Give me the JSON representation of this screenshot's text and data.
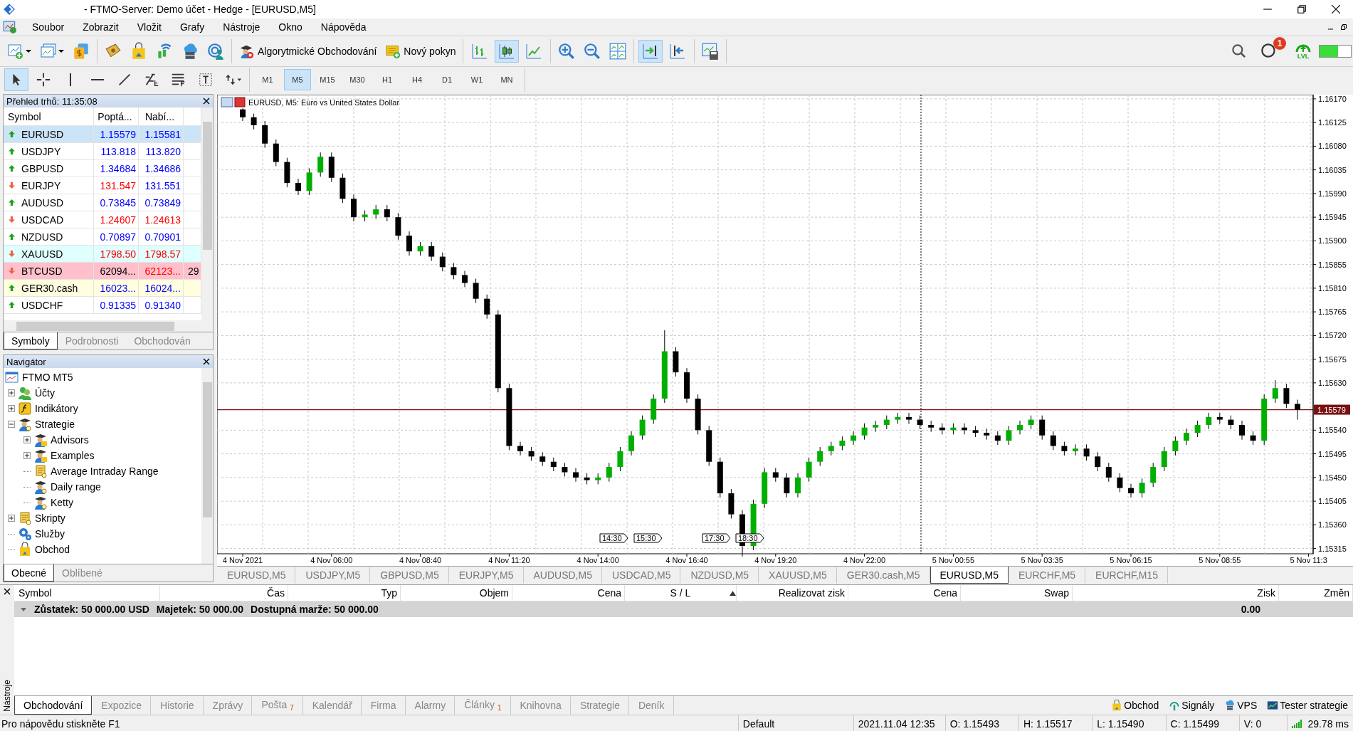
{
  "window": {
    "title": "- FTMO-Server: Demo účet - Hedge - [EURUSD,M5]"
  },
  "menu": [
    "Soubor",
    "Zobrazit",
    "Vložit",
    "Grafy",
    "Nástroje",
    "Okno",
    "Nápověda"
  ],
  "toolbar": {
    "algo_trading": "Algorytmické Obchodování",
    "new_order": "Nový pokyn",
    "chart_types": [
      {
        "kind": "bars",
        "selected": false
      },
      {
        "kind": "candles",
        "selected": true
      },
      {
        "kind": "line",
        "selected": false
      }
    ],
    "scroll_tools": [
      {
        "kind": "autoscroll",
        "selected": true
      },
      {
        "kind": "shift",
        "selected": false
      }
    ],
    "notification_count": "1",
    "signal_label": "LVL"
  },
  "drawing_tools": [
    {
      "kind": "cursor",
      "selected": true
    },
    {
      "kind": "crosshair",
      "selected": false
    },
    {
      "kind": "vline",
      "selected": false
    },
    {
      "kind": "hline",
      "selected": false
    },
    {
      "kind": "trendline",
      "selected": false
    },
    {
      "kind": "fibo",
      "selected": false
    },
    {
      "kind": "channel",
      "selected": false
    },
    {
      "kind": "text",
      "selected": false
    },
    {
      "kind": "arrows",
      "selected": false
    }
  ],
  "timeframes": [
    {
      "label": "M1",
      "selected": false
    },
    {
      "label": "M5",
      "selected": true
    },
    {
      "label": "M15",
      "selected": false
    },
    {
      "label": "M30",
      "selected": false
    },
    {
      "label": "H1",
      "selected": false
    },
    {
      "label": "H4",
      "selected": false
    },
    {
      "label": "D1",
      "selected": false
    },
    {
      "label": "W1",
      "selected": false
    },
    {
      "label": "MN",
      "selected": false
    }
  ],
  "market_watch": {
    "title": "Přehled trhů: 11:35:08",
    "columns": [
      "Symbol",
      "Poptá...",
      "Nabí..."
    ],
    "rows": [
      {
        "symbol": "EURUSD",
        "bid": "1.15579",
        "ask": "1.15581",
        "rising": true,
        "bid_rising": true,
        "ask_rising": true,
        "selected": true
      },
      {
        "symbol": "USDJPY",
        "bid": "113.818",
        "ask": "113.820",
        "rising": true,
        "bid_rising": true,
        "ask_rising": true,
        "selected": false
      },
      {
        "symbol": "GBPUSD",
        "bid": "1.34684",
        "ask": "1.34686",
        "rising": true,
        "bid_rising": true,
        "ask_rising": true,
        "selected": false
      },
      {
        "symbol": "EURJPY",
        "bid": "131.547",
        "ask": "131.551",
        "rising": false,
        "bid_rising": false,
        "ask_rising": true,
        "selected": false
      },
      {
        "symbol": "AUDUSD",
        "bid": "0.73845",
        "ask": "0.73849",
        "rising": true,
        "bid_rising": true,
        "ask_rising": true,
        "selected": false
      },
      {
        "symbol": "USDCAD",
        "bid": "1.24607",
        "ask": "1.24613",
        "rising": false,
        "bid_rising": false,
        "ask_rising": false,
        "selected": false
      },
      {
        "symbol": "NZDUSD",
        "bid": "0.70897",
        "ask": "0.70901",
        "rising": true,
        "bid_rising": true,
        "ask_rising": true,
        "selected": false
      },
      {
        "symbol": "XAUUSD",
        "bid": "1798.50",
        "ask": "1798.57",
        "rising": false,
        "bid_rising": false,
        "ask_rising": false,
        "selected": false,
        "color": "#e0ffff"
      },
      {
        "symbol": "BTCUSD",
        "bid": "62094...",
        "ask": "62123...",
        "column_4": "29",
        "rising": false,
        "bid_unchanged": true,
        "ask_rising": false,
        "selected": false,
        "color": "#ffc0cb"
      },
      {
        "symbol": "GER30.cash",
        "bid": "16023...",
        "ask": "16024...",
        "rising": true,
        "bid_rising": true,
        "ask_rising": true,
        "selected": false,
        "color": "#ffffe0"
      },
      {
        "symbol": "USDCHF",
        "bid": "0.91335",
        "ask": "0.91340",
        "rising": true,
        "bid_rising": true,
        "ask_rising": true,
        "selected": false
      }
    ],
    "tabs": [
      {
        "label": "Symboly",
        "selected": true
      },
      {
        "label": "Podrobnosti",
        "selected": false
      },
      {
        "label": "Obchodován",
        "selected": false
      }
    ]
  },
  "navigator": {
    "title": "Navigátor",
    "items": [
      {
        "label": "FTMO MT5",
        "kind": "terminal",
        "children": [
          {
            "label": "Účty",
            "kind": "accounts",
            "expanded": false
          },
          {
            "label": "Indikátory",
            "kind": "indicators",
            "expanded": false
          },
          {
            "label": "Strategie",
            "kind": "experts",
            "expanded": true,
            "children": [
              {
                "label": "Advisors",
                "kind": "expert-folder",
                "expanded": false
              },
              {
                "label": "Examples",
                "kind": "expert-folder",
                "expanded": false
              },
              {
                "label": "Average Intraday Range",
                "kind": "script"
              },
              {
                "label": "Daily range",
                "kind": "expert"
              },
              {
                "label": "Ketty",
                "kind": "expert"
              }
            ]
          },
          {
            "label": "Skripty",
            "kind": "script",
            "expanded": false
          },
          {
            "label": "Služby",
            "kind": "services"
          },
          {
            "label": "Obchod",
            "kind": "market"
          }
        ]
      }
    ],
    "tabs": [
      {
        "label": "Obecné",
        "selected": true
      },
      {
        "label": "Oblíbené",
        "selected": false
      }
    ]
  },
  "chart": {
    "header": "EURUSD, M5:  Euro vs United States Dollar",
    "chart_data": {
      "type": "candlestick",
      "categories": [
        "4 Nov 2021",
        null,
        null,
        null,
        null,
        null,
        null,
        null,
        "4 Nov 06:00",
        null,
        null,
        null,
        null,
        null,
        null,
        null,
        "4 Nov 08:40",
        null,
        null,
        null,
        null,
        null,
        null,
        null,
        "4 Nov 11:20",
        null,
        null,
        null,
        null,
        null,
        null,
        null,
        "4 Nov 14:00",
        null,
        null,
        null,
        null,
        null,
        null,
        null,
        "4 Nov 16:40",
        null,
        null,
        null,
        null,
        null,
        null,
        null,
        "4 Nov 19:20",
        null,
        null,
        null,
        null,
        null,
        null,
        null,
        "4 Nov 22:00",
        null,
        null,
        null,
        null,
        null,
        null,
        null,
        "5 Nov 00:55",
        null,
        null,
        null,
        null,
        null,
        null,
        null,
        "5 Nov 03:35",
        null,
        null,
        null,
        null,
        null,
        null,
        null,
        "5 Nov 06:15",
        null,
        null,
        null,
        null,
        null,
        null,
        null,
        "5 Nov 08:55",
        null,
        null,
        null,
        null,
        null,
        null,
        null,
        "5 Nov 11:3"
      ],
      "ohlc": [
        [
          1.1615,
          1.16152,
          1.16128,
          1.16135
        ],
        [
          1.16135,
          1.16142,
          1.16112,
          1.1612
        ],
        [
          1.1612,
          1.16128,
          1.16077,
          1.16085
        ],
        [
          1.16085,
          1.16093,
          1.16042,
          1.1605
        ],
        [
          1.1605,
          1.16058,
          1.16002,
          1.1601
        ],
        [
          1.1601,
          1.16018,
          1.15987,
          1.15995
        ],
        [
          1.15995,
          1.16038,
          1.15987,
          1.1603
        ],
        [
          1.1603,
          1.16068,
          1.16022,
          1.1606
        ],
        [
          1.1606,
          1.16068,
          1.16012,
          1.1602
        ],
        [
          1.1602,
          1.16028,
          1.15972,
          1.1598
        ],
        [
          1.1598,
          1.15988,
          1.15937,
          1.15945
        ],
        [
          1.15945,
          1.15958,
          1.15937,
          1.1595
        ],
        [
          1.1595,
          1.15968,
          1.15942,
          1.1596
        ],
        [
          1.1596,
          1.15968,
          1.15937,
          1.15945
        ],
        [
          1.15945,
          1.15953,
          1.15902,
          1.1591
        ],
        [
          1.1591,
          1.15918,
          1.15872,
          1.1588
        ],
        [
          1.1588,
          1.15898,
          1.15872,
          1.1589
        ],
        [
          1.1589,
          1.15898,
          1.15862,
          1.1587
        ],
        [
          1.1587,
          1.15878,
          1.15842,
          1.1585
        ],
        [
          1.1585,
          1.15858,
          1.15827,
          1.15835
        ],
        [
          1.15835,
          1.15843,
          1.15812,
          1.1582
        ],
        [
          1.1582,
          1.15828,
          1.15782,
          1.1579
        ],
        [
          1.1579,
          1.15798,
          1.15752,
          1.1576
        ],
        [
          1.1576,
          1.15768,
          1.15612,
          1.1562
        ],
        [
          1.1562,
          1.15628,
          1.15502,
          1.1551
        ],
        [
          1.1551,
          1.15518,
          1.15492,
          1.155
        ],
        [
          1.155,
          1.15508,
          1.15482,
          1.1549
        ],
        [
          1.1549,
          1.15498,
          1.15472,
          1.1548
        ],
        [
          1.1548,
          1.15488,
          1.15462,
          1.1547
        ],
        [
          1.1547,
          1.15478,
          1.15452,
          1.1546
        ],
        [
          1.1546,
          1.15468,
          1.15442,
          1.1545
        ],
        [
          1.1545,
          1.15458,
          1.15437,
          1.15445
        ],
        [
          1.15445,
          1.15458,
          1.15437,
          1.1545
        ],
        [
          1.1545,
          1.15478,
          1.15442,
          1.1547
        ],
        [
          1.1547,
          1.15508,
          1.15462,
          1.155
        ],
        [
          1.155,
          1.15538,
          1.15492,
          1.1553
        ],
        [
          1.1553,
          1.15568,
          1.15522,
          1.1556
        ],
        [
          1.1556,
          1.15608,
          1.15552,
          1.156
        ],
        [
          1.156,
          1.1573,
          1.15592,
          1.1569
        ],
        [
          1.1569,
          1.15698,
          1.15642,
          1.1565
        ],
        [
          1.1565,
          1.15658,
          1.15592,
          1.156
        ],
        [
          1.156,
          1.15608,
          1.15532,
          1.1554
        ],
        [
          1.1554,
          1.15548,
          1.15472,
          1.1548
        ],
        [
          1.1548,
          1.15488,
          1.15412,
          1.1542
        ],
        [
          1.1542,
          1.15428,
          1.15372,
          1.1538
        ],
        [
          1.1538,
          1.15388,
          1.153,
          1.1532
        ],
        [
          1.1532,
          1.15408,
          1.15312,
          1.154
        ],
        [
          1.154,
          1.15468,
          1.15392,
          1.1546
        ],
        [
          1.1546,
          1.15468,
          1.15442,
          1.1545
        ],
        [
          1.1545,
          1.15458,
          1.15412,
          1.1542
        ],
        [
          1.1542,
          1.15458,
          1.15412,
          1.1545
        ],
        [
          1.1545,
          1.15488,
          1.15442,
          1.1548
        ],
        [
          1.1548,
          1.15508,
          1.15472,
          1.155
        ],
        [
          1.155,
          1.15518,
          1.15492,
          1.1551
        ],
        [
          1.1551,
          1.15528,
          1.15502,
          1.1552
        ],
        [
          1.1552,
          1.15538,
          1.15512,
          1.1553
        ],
        [
          1.1553,
          1.15553,
          1.15522,
          1.15545
        ],
        [
          1.15545,
          1.15558,
          1.15537,
          1.1555
        ],
        [
          1.1555,
          1.15568,
          1.15542,
          1.1556
        ],
        [
          1.1556,
          1.15573,
          1.15552,
          1.15565
        ],
        [
          1.15565,
          1.15573,
          1.15552,
          1.1556
        ],
        [
          1.1556,
          1.15568,
          1.15542,
          1.1555
        ],
        [
          1.1555,
          1.15558,
          1.15537,
          1.15545
        ],
        [
          1.15545,
          1.15553,
          1.15532,
          1.1554
        ],
        [
          1.1554,
          1.15553,
          1.15532,
          1.15545
        ],
        [
          1.15545,
          1.15553,
          1.15532,
          1.1554
        ],
        [
          1.1554,
          1.15548,
          1.15527,
          1.15535
        ],
        [
          1.15535,
          1.15543,
          1.15522,
          1.1553
        ],
        [
          1.1553,
          1.15538,
          1.15512,
          1.1552
        ],
        [
          1.1552,
          1.15548,
          1.15512,
          1.1554
        ],
        [
          1.1554,
          1.15558,
          1.15532,
          1.1555
        ],
        [
          1.1555,
          1.15568,
          1.15542,
          1.1556
        ],
        [
          1.1556,
          1.15568,
          1.15522,
          1.1553
        ],
        [
          1.1553,
          1.15538,
          1.15502,
          1.1551
        ],
        [
          1.1551,
          1.15518,
          1.15492,
          1.155
        ],
        [
          1.155,
          1.15513,
          1.15492,
          1.15505
        ],
        [
          1.15505,
          1.15513,
          1.15482,
          1.1549
        ],
        [
          1.1549,
          1.15498,
          1.15462,
          1.1547
        ],
        [
          1.1547,
          1.15478,
          1.15442,
          1.1545
        ],
        [
          1.1545,
          1.15458,
          1.15422,
          1.1543
        ],
        [
          1.1543,
          1.15438,
          1.15412,
          1.1542
        ],
        [
          1.1542,
          1.15448,
          1.15412,
          1.1544
        ],
        [
          1.1544,
          1.15478,
          1.15432,
          1.1547
        ],
        [
          1.1547,
          1.15508,
          1.15462,
          1.155
        ],
        [
          1.155,
          1.15528,
          1.15492,
          1.1552
        ],
        [
          1.1552,
          1.15543,
          1.15512,
          1.15535
        ],
        [
          1.15535,
          1.15558,
          1.15527,
          1.1555
        ],
        [
          1.1555,
          1.15573,
          1.15542,
          1.15565
        ],
        [
          1.15565,
          1.15573,
          1.15552,
          1.1556
        ],
        [
          1.1556,
          1.15568,
          1.15542,
          1.1555
        ],
        [
          1.1555,
          1.15558,
          1.15522,
          1.1553
        ],
        [
          1.1553,
          1.15538,
          1.15512,
          1.1552
        ],
        [
          1.1552,
          1.15608,
          1.15512,
          1.156
        ],
        [
          1.156,
          1.15635,
          1.15592,
          1.1562
        ],
        [
          1.1562,
          1.15628,
          1.15582,
          1.1559
        ],
        [
          1.1559,
          1.15598,
          1.1556,
          1.15579
        ],
        null
      ],
      "ylim": [
        1.15305,
        1.16178
      ],
      "grid": true,
      "ref_lines": [
        {
          "axis": "y",
          "value": 1.15579,
          "label": "1.15579",
          "color": "#7a1010"
        }
      ],
      "yticks": [
        {
          "value": 1.1617,
          "label": "1.16170"
        },
        {
          "value": 1.16125,
          "label": "1.16125"
        },
        {
          "value": 1.1608,
          "label": "1.16080"
        },
        {
          "value": 1.16035,
          "label": "1.16035"
        },
        {
          "value": 1.1599,
          "label": "1.15990"
        },
        {
          "value": 1.15945,
          "label": "1.15945"
        },
        {
          "value": 1.159,
          "label": "1.15900"
        },
        {
          "value": 1.15855,
          "label": "1.15855"
        },
        {
          "value": 1.1581,
          "label": "1.15810"
        },
        {
          "value": 1.15765,
          "label": "1.15765"
        },
        {
          "value": 1.1572,
          "label": "1.15720"
        },
        {
          "value": 1.15675,
          "label": "1.15675"
        },
        {
          "value": 1.1563,
          "label": "1.15630"
        },
        {
          "value": 1.1554,
          "label": "1.15540"
        },
        {
          "value": 1.15495,
          "label": "1.15495"
        },
        {
          "value": 1.1545,
          "label": "1.15450"
        },
        {
          "value": 1.15405,
          "label": "1.15405"
        },
        {
          "value": 1.1536,
          "label": "1.15360"
        },
        {
          "value": 1.15315,
          "label": "1.15315"
        }
      ]
    },
    "time_markers": [
      "14:30",
      "15:30",
      "17:30",
      "18:30"
    ],
    "tabs": [
      {
        "label": "EURUSD,M5",
        "selected": false
      },
      {
        "label": "USDJPY,M5",
        "selected": false
      },
      {
        "label": "GBPUSD,M5",
        "selected": false
      },
      {
        "label": "EURJPY,M5",
        "selected": false
      },
      {
        "label": "AUDUSD,M5",
        "selected": false
      },
      {
        "label": "USDCAD,M5",
        "selected": false
      },
      {
        "label": "NZDUSD,M5",
        "selected": false
      },
      {
        "label": "XAUUSD,M5",
        "selected": false
      },
      {
        "label": "GER30.cash,M5",
        "selected": false
      },
      {
        "label": "EURUSD,M5",
        "selected": true
      },
      {
        "label": "EURCHF,M5",
        "selected": false
      },
      {
        "label": "EURCHF,M15",
        "selected": false
      }
    ]
  },
  "toolbox": {
    "side_label": "Nástroje",
    "columns": [
      "Symbol",
      "Čas",
      "Typ",
      "Objem",
      "Cena",
      "S / L",
      "Realizovat zisk",
      "Cena",
      "Swap",
      "Zisk",
      "Změn"
    ],
    "balance": {
      "balance": "Zůstatek: 50 000.00 USD",
      "equity": "Majetek: 50 000.00",
      "free_margin": "Dostupná marže: 50 000.00",
      "profit": "0.00"
    },
    "tabs": [
      {
        "label": "Obchodování",
        "selected": true
      },
      {
        "label": "Expozice",
        "selected": false
      },
      {
        "label": "Historie",
        "selected": false
      },
      {
        "label": "Zprávy",
        "selected": false
      },
      {
        "label": "Pošta",
        "badge": "7",
        "selected": false
      },
      {
        "label": "Kalendář",
        "selected": false
      },
      {
        "label": "Firma",
        "selected": false
      },
      {
        "label": "Alarmy",
        "selected": false
      },
      {
        "label": "Články",
        "badge": "1",
        "selected": false
      },
      {
        "label": "Knihovna",
        "selected": false
      },
      {
        "label": "Strategie",
        "selected": false
      },
      {
        "label": "Deník",
        "selected": false
      }
    ],
    "services": [
      {
        "label": "Obchod",
        "kind": "market"
      },
      {
        "label": "Signály",
        "kind": "signals"
      },
      {
        "label": "VPS",
        "kind": "vps"
      },
      {
        "label": "Tester strategie",
        "kind": "tester"
      }
    ]
  },
  "status_bar": {
    "help": "Pro nápovědu stiskněte F1",
    "profile": "Default",
    "time": "2021.11.04 12:35",
    "open": "O: 1.15493",
    "high": "H: 1.15517",
    "low": "L: 1.15490",
    "close": "C: 1.15499",
    "volume": "V: 0",
    "ping": "29.78 ms"
  }
}
